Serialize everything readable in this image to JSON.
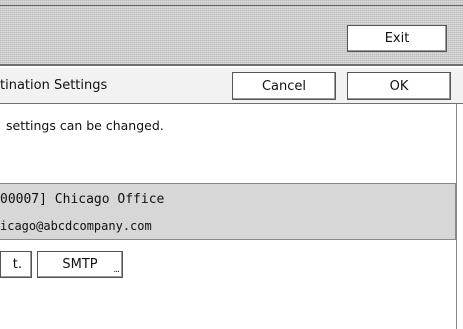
{
  "header": {
    "exit_label": "Exit"
  },
  "dialog": {
    "title": "tination Settings",
    "cancel_label": "Cancel",
    "ok_label": "OK",
    "message": "settings can be changed."
  },
  "entry": {
    "line1": "00007] Chicago Office",
    "line2": "icago@abcdcompany.com"
  },
  "buttons": {
    "protection_label": "t.",
    "smtp_label": "SMTP",
    "smtp_more": "..."
  }
}
